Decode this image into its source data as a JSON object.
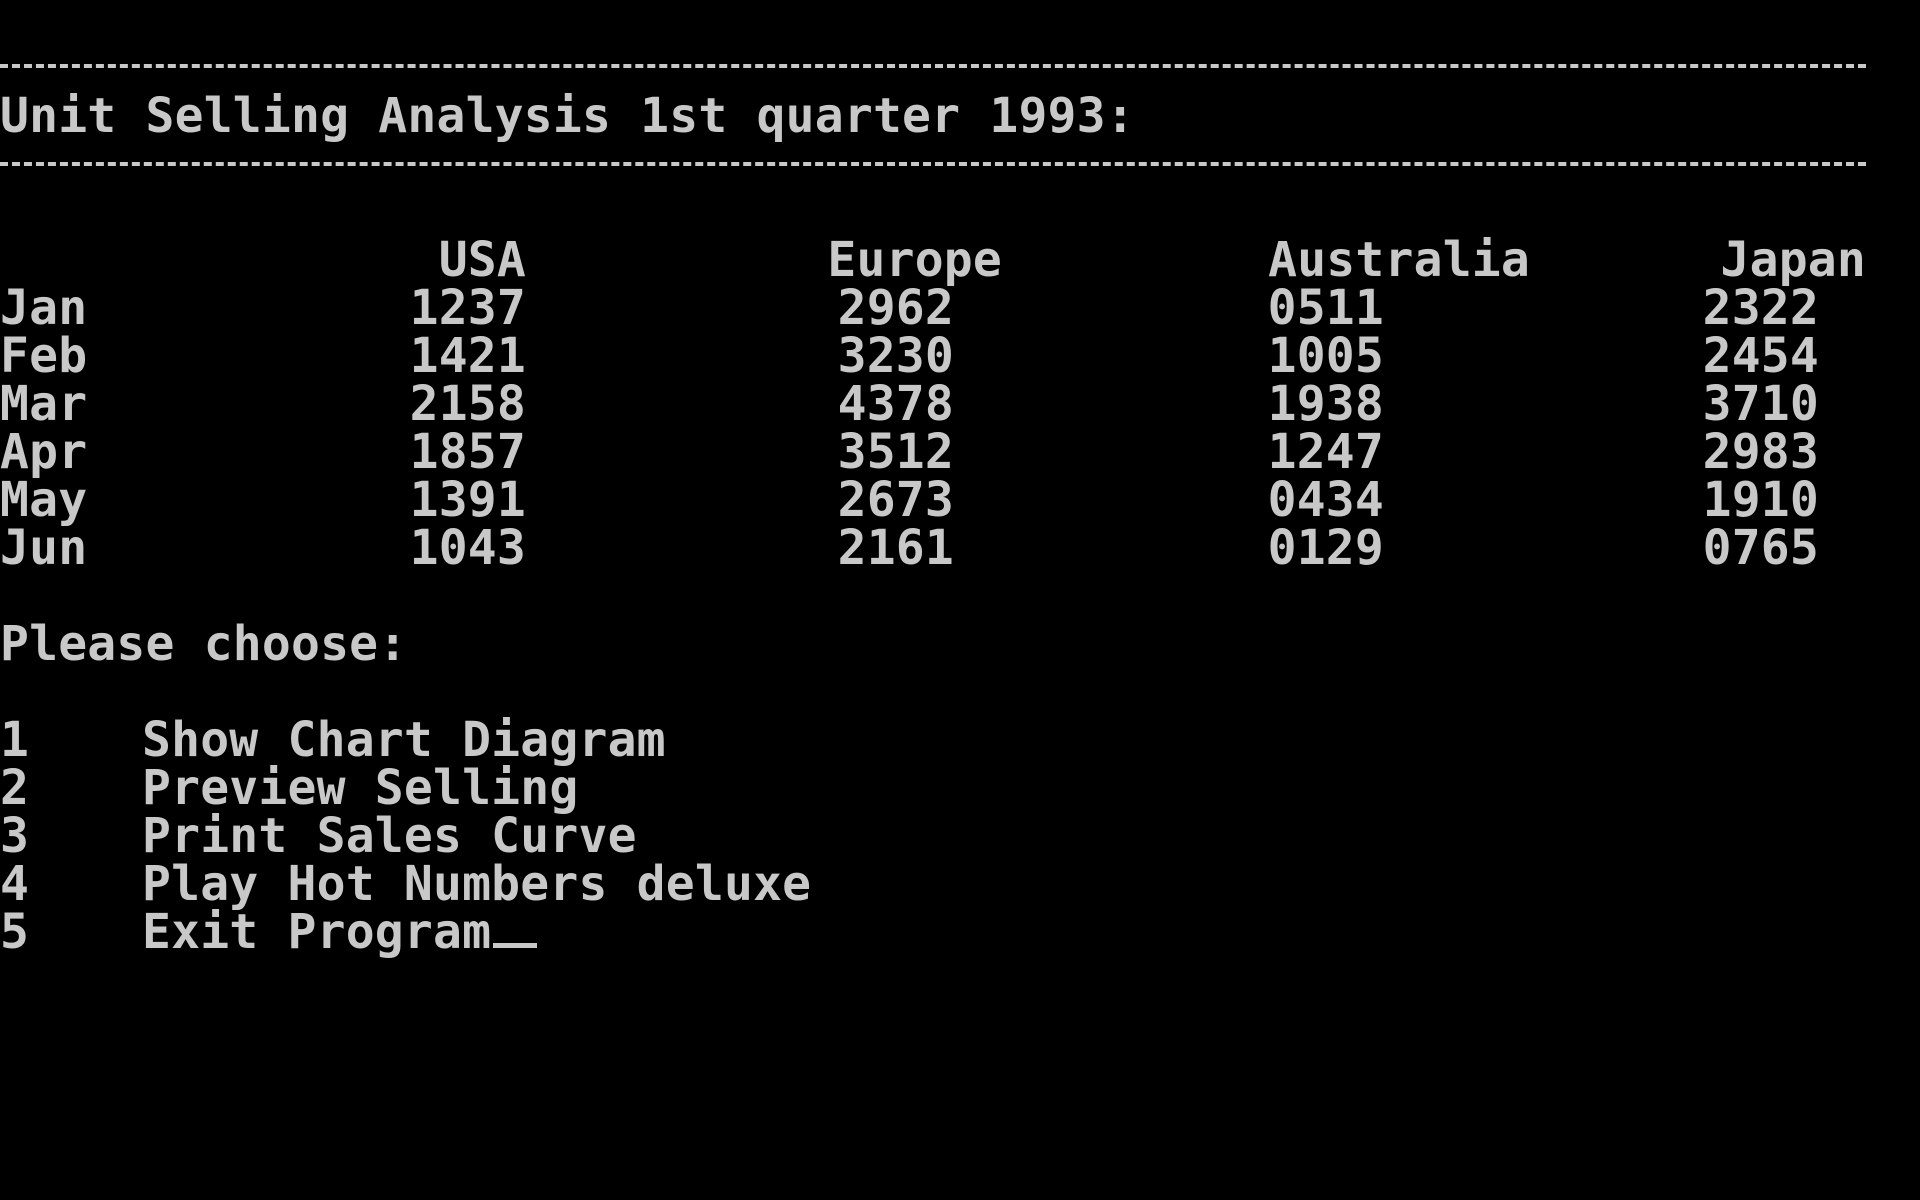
{
  "screen": {
    "title": "Unit Selling Analysis 1st quarter 1993:",
    "prompt": "Please choose:"
  },
  "table": {
    "columns": [
      "USA",
      "Europe",
      "Australia",
      "Japan"
    ],
    "rows": [
      {
        "month": "Jan",
        "values": [
          "1237",
          "2962",
          "0511",
          "2322"
        ]
      },
      {
        "month": "Feb",
        "values": [
          "1421",
          "3230",
          "1005",
          "2454"
        ]
      },
      {
        "month": "Mar",
        "values": [
          "2158",
          "4378",
          "1938",
          "3710"
        ]
      },
      {
        "month": "Apr",
        "values": [
          "1857",
          "3512",
          "1247",
          "2983"
        ]
      },
      {
        "month": "May",
        "values": [
          "1391",
          "2673",
          "0434",
          "1910"
        ]
      },
      {
        "month": "Jun",
        "values": [
          "1043",
          "2161",
          "0129",
          "0765"
        ]
      }
    ]
  },
  "menu": {
    "items": [
      {
        "key": "1",
        "label": "Show Chart Diagram"
      },
      {
        "key": "2",
        "label": "Preview Selling"
      },
      {
        "key": "3",
        "label": "Print Sales Curve"
      },
      {
        "key": "4",
        "label": "Play Hot Numbers deluxe"
      },
      {
        "key": "5",
        "label": "Exit Program"
      }
    ]
  },
  "colors": {
    "background": "#000000",
    "text": "#c8c8c8"
  }
}
